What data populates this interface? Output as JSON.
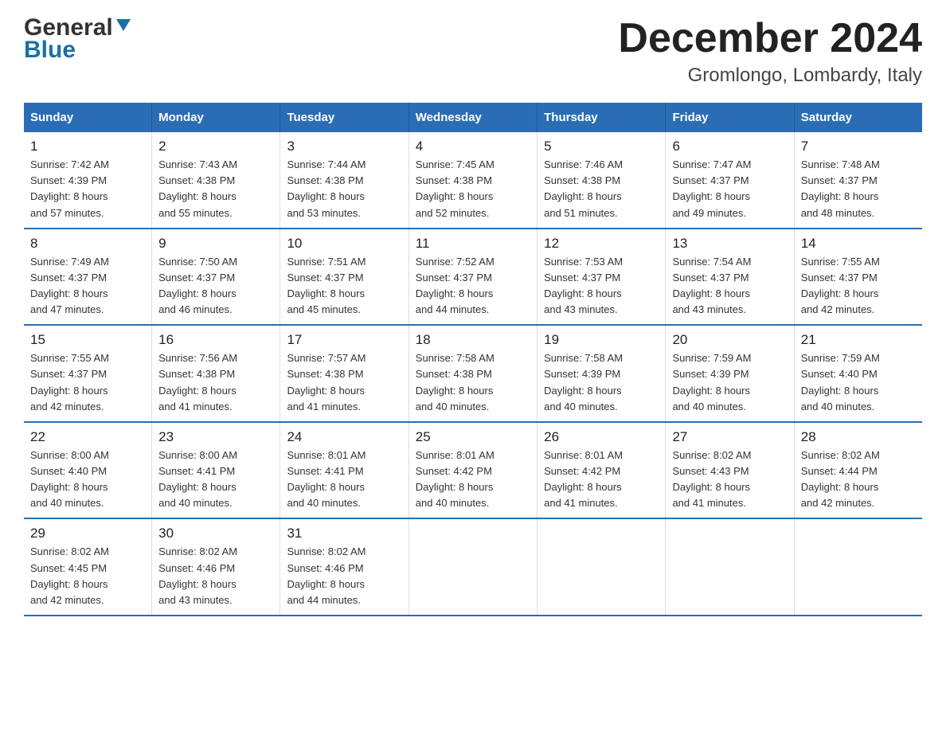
{
  "header": {
    "title": "December 2024",
    "subtitle": "Gromlongo, Lombardy, Italy",
    "logo_general": "General",
    "logo_blue": "Blue"
  },
  "days_of_week": [
    "Sunday",
    "Monday",
    "Tuesday",
    "Wednesday",
    "Thursday",
    "Friday",
    "Saturday"
  ],
  "weeks": [
    [
      {
        "day": "1",
        "sunrise": "7:42 AM",
        "sunset": "4:39 PM",
        "daylight": "8 hours and 57 minutes."
      },
      {
        "day": "2",
        "sunrise": "7:43 AM",
        "sunset": "4:38 PM",
        "daylight": "8 hours and 55 minutes."
      },
      {
        "day": "3",
        "sunrise": "7:44 AM",
        "sunset": "4:38 PM",
        "daylight": "8 hours and 53 minutes."
      },
      {
        "day": "4",
        "sunrise": "7:45 AM",
        "sunset": "4:38 PM",
        "daylight": "8 hours and 52 minutes."
      },
      {
        "day": "5",
        "sunrise": "7:46 AM",
        "sunset": "4:38 PM",
        "daylight": "8 hours and 51 minutes."
      },
      {
        "day": "6",
        "sunrise": "7:47 AM",
        "sunset": "4:37 PM",
        "daylight": "8 hours and 49 minutes."
      },
      {
        "day": "7",
        "sunrise": "7:48 AM",
        "sunset": "4:37 PM",
        "daylight": "8 hours and 48 minutes."
      }
    ],
    [
      {
        "day": "8",
        "sunrise": "7:49 AM",
        "sunset": "4:37 PM",
        "daylight": "8 hours and 47 minutes."
      },
      {
        "day": "9",
        "sunrise": "7:50 AM",
        "sunset": "4:37 PM",
        "daylight": "8 hours and 46 minutes."
      },
      {
        "day": "10",
        "sunrise": "7:51 AM",
        "sunset": "4:37 PM",
        "daylight": "8 hours and 45 minutes."
      },
      {
        "day": "11",
        "sunrise": "7:52 AM",
        "sunset": "4:37 PM",
        "daylight": "8 hours and 44 minutes."
      },
      {
        "day": "12",
        "sunrise": "7:53 AM",
        "sunset": "4:37 PM",
        "daylight": "8 hours and 43 minutes."
      },
      {
        "day": "13",
        "sunrise": "7:54 AM",
        "sunset": "4:37 PM",
        "daylight": "8 hours and 43 minutes."
      },
      {
        "day": "14",
        "sunrise": "7:55 AM",
        "sunset": "4:37 PM",
        "daylight": "8 hours and 42 minutes."
      }
    ],
    [
      {
        "day": "15",
        "sunrise": "7:55 AM",
        "sunset": "4:37 PM",
        "daylight": "8 hours and 42 minutes."
      },
      {
        "day": "16",
        "sunrise": "7:56 AM",
        "sunset": "4:38 PM",
        "daylight": "8 hours and 41 minutes."
      },
      {
        "day": "17",
        "sunrise": "7:57 AM",
        "sunset": "4:38 PM",
        "daylight": "8 hours and 41 minutes."
      },
      {
        "day": "18",
        "sunrise": "7:58 AM",
        "sunset": "4:38 PM",
        "daylight": "8 hours and 40 minutes."
      },
      {
        "day": "19",
        "sunrise": "7:58 AM",
        "sunset": "4:39 PM",
        "daylight": "8 hours and 40 minutes."
      },
      {
        "day": "20",
        "sunrise": "7:59 AM",
        "sunset": "4:39 PM",
        "daylight": "8 hours and 40 minutes."
      },
      {
        "day": "21",
        "sunrise": "7:59 AM",
        "sunset": "4:40 PM",
        "daylight": "8 hours and 40 minutes."
      }
    ],
    [
      {
        "day": "22",
        "sunrise": "8:00 AM",
        "sunset": "4:40 PM",
        "daylight": "8 hours and 40 minutes."
      },
      {
        "day": "23",
        "sunrise": "8:00 AM",
        "sunset": "4:41 PM",
        "daylight": "8 hours and 40 minutes."
      },
      {
        "day": "24",
        "sunrise": "8:01 AM",
        "sunset": "4:41 PM",
        "daylight": "8 hours and 40 minutes."
      },
      {
        "day": "25",
        "sunrise": "8:01 AM",
        "sunset": "4:42 PM",
        "daylight": "8 hours and 40 minutes."
      },
      {
        "day": "26",
        "sunrise": "8:01 AM",
        "sunset": "4:42 PM",
        "daylight": "8 hours and 41 minutes."
      },
      {
        "day": "27",
        "sunrise": "8:02 AM",
        "sunset": "4:43 PM",
        "daylight": "8 hours and 41 minutes."
      },
      {
        "day": "28",
        "sunrise": "8:02 AM",
        "sunset": "4:44 PM",
        "daylight": "8 hours and 42 minutes."
      }
    ],
    [
      {
        "day": "29",
        "sunrise": "8:02 AM",
        "sunset": "4:45 PM",
        "daylight": "8 hours and 42 minutes."
      },
      {
        "day": "30",
        "sunrise": "8:02 AM",
        "sunset": "4:46 PM",
        "daylight": "8 hours and 43 minutes."
      },
      {
        "day": "31",
        "sunrise": "8:02 AM",
        "sunset": "4:46 PM",
        "daylight": "8 hours and 44 minutes."
      },
      null,
      null,
      null,
      null
    ]
  ],
  "labels": {
    "sunrise": "Sunrise:",
    "sunset": "Sunset:",
    "daylight": "Daylight:"
  }
}
